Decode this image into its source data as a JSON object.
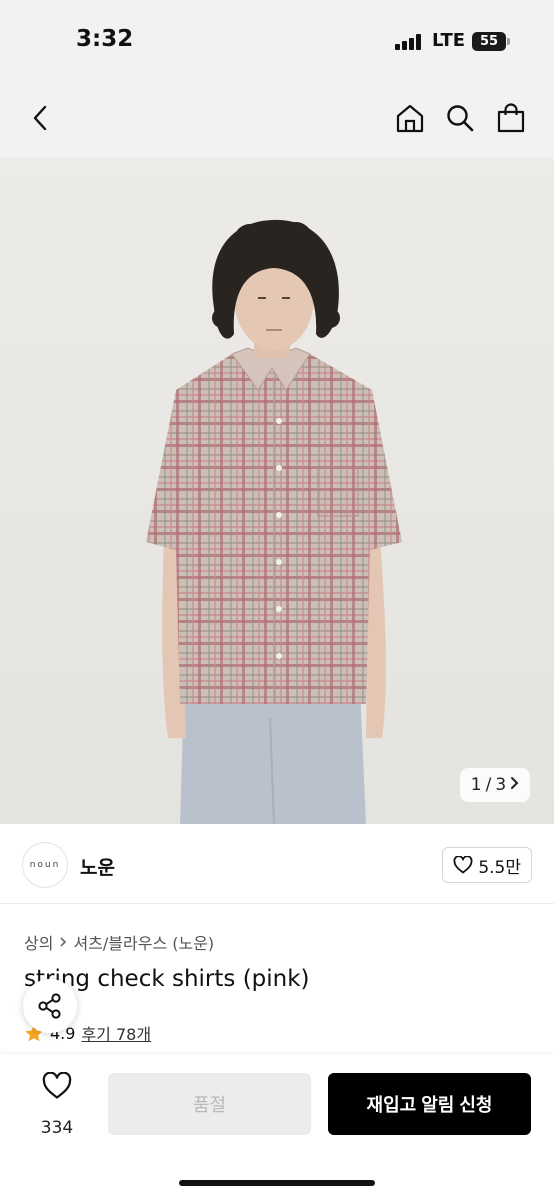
{
  "status_bar": {
    "time": "3:32",
    "network": "LTE",
    "battery": "55"
  },
  "nav": {
    "back_icon": "chevron-left-icon",
    "home_icon": "home-icon",
    "search_icon": "search-icon",
    "cart_icon": "shopping-bag-icon"
  },
  "gallery": {
    "current": "1",
    "total": "3",
    "separator": "/",
    "next_icon": "chevron-right-icon"
  },
  "brand": {
    "logo_text": "noun",
    "name": "노운",
    "like_count": "5.5만"
  },
  "product": {
    "breadcrumb": [
      "상의",
      "셔츠/블라우스 (노운)"
    ],
    "title": "string check shirts (pink)",
    "rating": "4.9",
    "review_link": "후기 78개"
  },
  "bottom_bar": {
    "wish_count": "334",
    "soldout_label": "품절",
    "restock_label": "재입고 알림 신청"
  },
  "colors": {
    "accent": "#000000",
    "star": "#f5a623",
    "disabled_bg": "#ececec"
  }
}
